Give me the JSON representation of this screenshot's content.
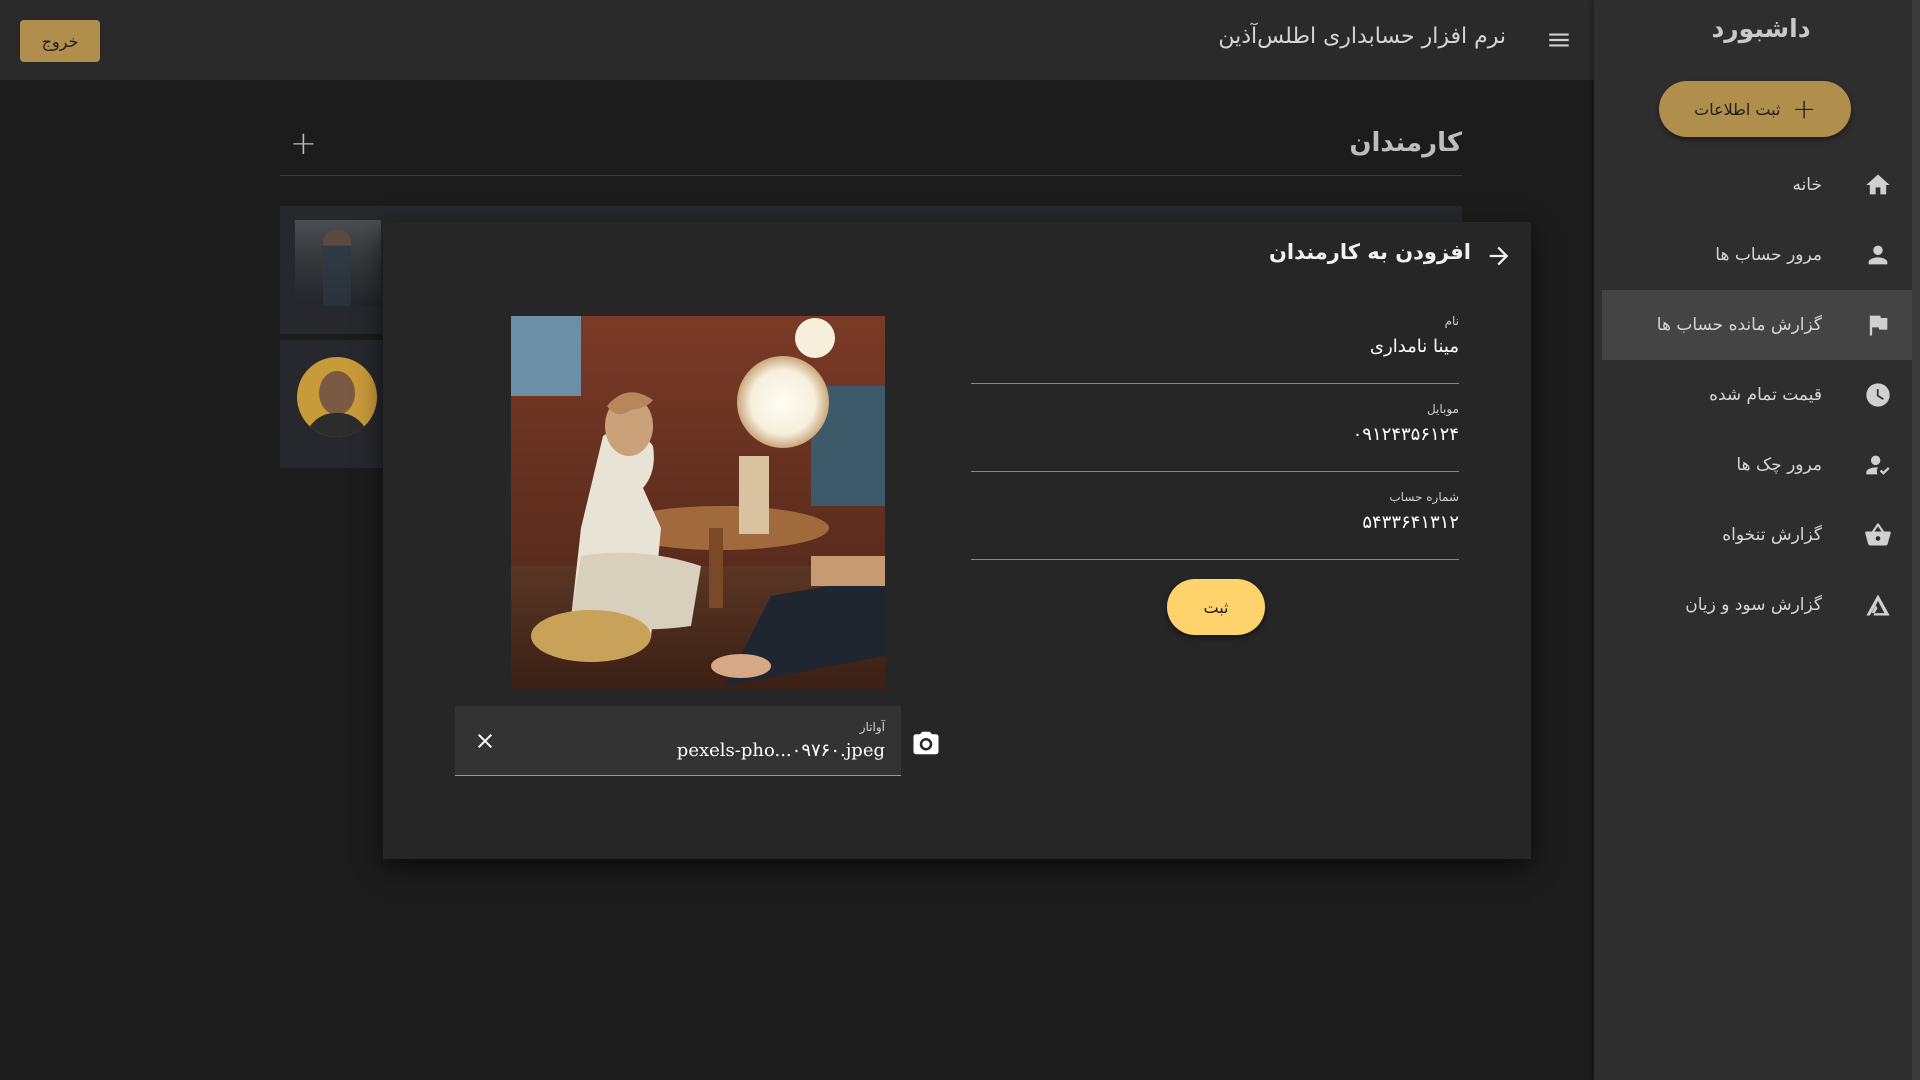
{
  "topbar": {
    "app_title": "نرم افزار حسابداری اطلس‌آذین",
    "logout_label": "خروج"
  },
  "sidebar": {
    "title": "داشبورد",
    "register_label": "ثبت اطلاعات",
    "items": [
      {
        "label": "خانه",
        "icon": "home-icon"
      },
      {
        "label": "مرور حساب ها",
        "icon": "person-icon"
      },
      {
        "label": "گزارش مانده حساب ها",
        "icon": "flag-icon",
        "active": true
      },
      {
        "label": "قیمت تمام شده",
        "icon": "clock-icon"
      },
      {
        "label": "مرور چک ها",
        "icon": "person-check-icon"
      },
      {
        "label": "گزارش تنخواه",
        "icon": "basket-icon"
      },
      {
        "label": "گزارش سود و زیان",
        "icon": "triangle-icon"
      }
    ]
  },
  "page": {
    "heading": "کارمندان",
    "add_symbol": "+"
  },
  "dialog": {
    "title": "افزودن به کارمندان",
    "fields": [
      {
        "label": "نام",
        "value": "مینا نامداری"
      },
      {
        "label": "موبایل",
        "value": "۰۹۱۲۴۳۵۶۱۲۴"
      },
      {
        "label": "شماره حساب",
        "value": "۵۴۳۳۶۴۱۳۱۲"
      }
    ],
    "submit_label": "ثبت",
    "avatar_label": "آواتار",
    "avatar_file": "pexels-pho...۰۹۷۶۰.jpeg"
  },
  "colors": {
    "accent": "#b08f4c",
    "submit": "#ffd36b",
    "sidebar_bg": "#2e2e2e",
    "topbar_bg": "#2a2a2a",
    "page_bg": "#1c1c1c",
    "dialog_bg": "#262626"
  }
}
